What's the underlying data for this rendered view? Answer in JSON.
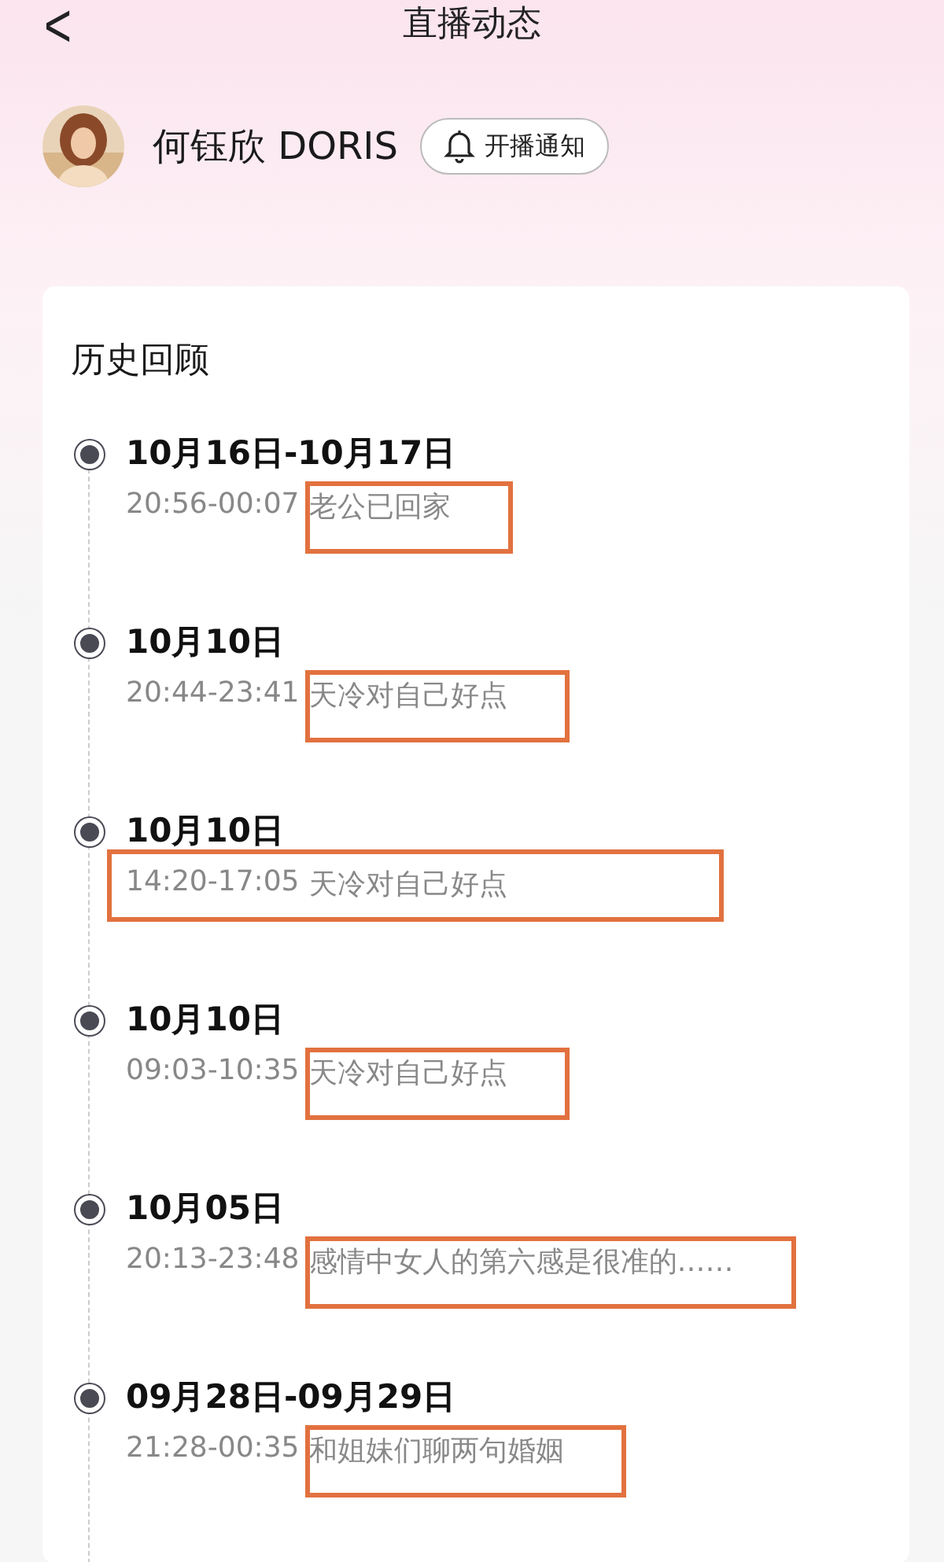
{
  "nav": {
    "back": "<",
    "title": "直播动态"
  },
  "profile": {
    "name": "何钰欣 DORIS",
    "notify_button": "开播通知"
  },
  "history": {
    "heading": "历史回顾",
    "entries": [
      {
        "date": "10月16日-10月17日",
        "time": "20:56-00:07",
        "title": "老公已回家",
        "framed_title": true,
        "framed_line": false
      },
      {
        "date": "10月10日",
        "time": "20:44-23:41",
        "title": "天冷对自己好点",
        "framed_title": true,
        "framed_line": false
      },
      {
        "date": "10月10日",
        "time": "14:20-17:05",
        "title": "天冷对自己好点",
        "framed_title": false,
        "framed_line": true
      },
      {
        "date": "10月10日",
        "time": "09:03-10:35",
        "title": "天冷对自己好点",
        "framed_title": true,
        "framed_line": false
      },
      {
        "date": "10月05日",
        "time": "20:13-23:48",
        "title": "感情中女人的第六感是很准的……",
        "framed_title": true,
        "framed_line": false
      },
      {
        "date": "09月28日-09月29日",
        "time": "21:28-00:35",
        "title": "和姐妹们聊两句婚姻",
        "framed_title": true,
        "framed_line": false
      }
    ]
  }
}
